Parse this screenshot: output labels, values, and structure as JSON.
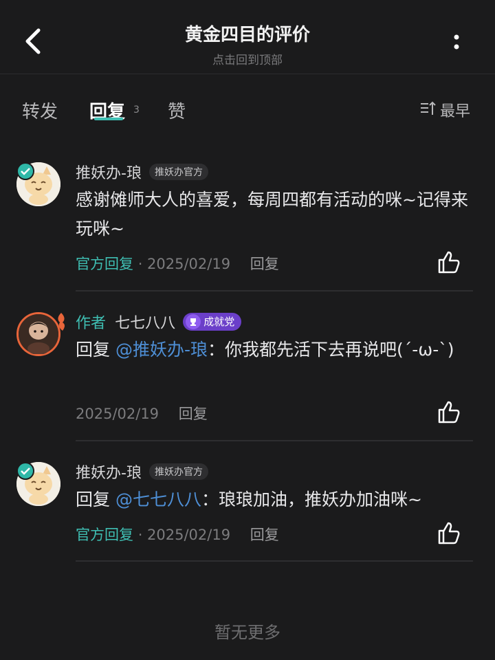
{
  "header": {
    "title": "黄金四目的评价",
    "subtitle": "点击回到顶部"
  },
  "tabs": [
    {
      "label": "转发"
    },
    {
      "label": "回复",
      "count": "3",
      "active": true
    },
    {
      "label": "赞"
    }
  ],
  "sort": {
    "label": "最早"
  },
  "comments": [
    {
      "name": "推妖办-琅",
      "tag": "推妖办官方",
      "text": "感谢傩师大人的喜爱，每周四都有活动的咪~记得来玩咪~",
      "official_label": "官方回复",
      "date": "· 2025/02/19",
      "reply_label": "回复"
    },
    {
      "author_label": "作者",
      "name": "七七八八",
      "tag": "成就党",
      "reply_prefix": "回复 ",
      "mention": "@推妖办-琅",
      "text": "：你我都先活下去再说吧(´-ω-`)",
      "date": "2025/02/19",
      "reply_label": "回复"
    },
    {
      "name": "推妖办-琅",
      "tag": "推妖办官方",
      "reply_prefix": "回复 ",
      "mention": "@七七八八",
      "text": "：琅琅加油，推妖办加油咪~",
      "official_label": "官方回复",
      "date": "· 2025/02/19",
      "reply_label": "回复"
    }
  ],
  "footer": {
    "text": "暂无更多"
  },
  "colors": {
    "accent": "#3fbfb3",
    "mention": "#4e8fd6",
    "badge_purple": "#6b3fc9",
    "background": "#1b1b1c"
  }
}
